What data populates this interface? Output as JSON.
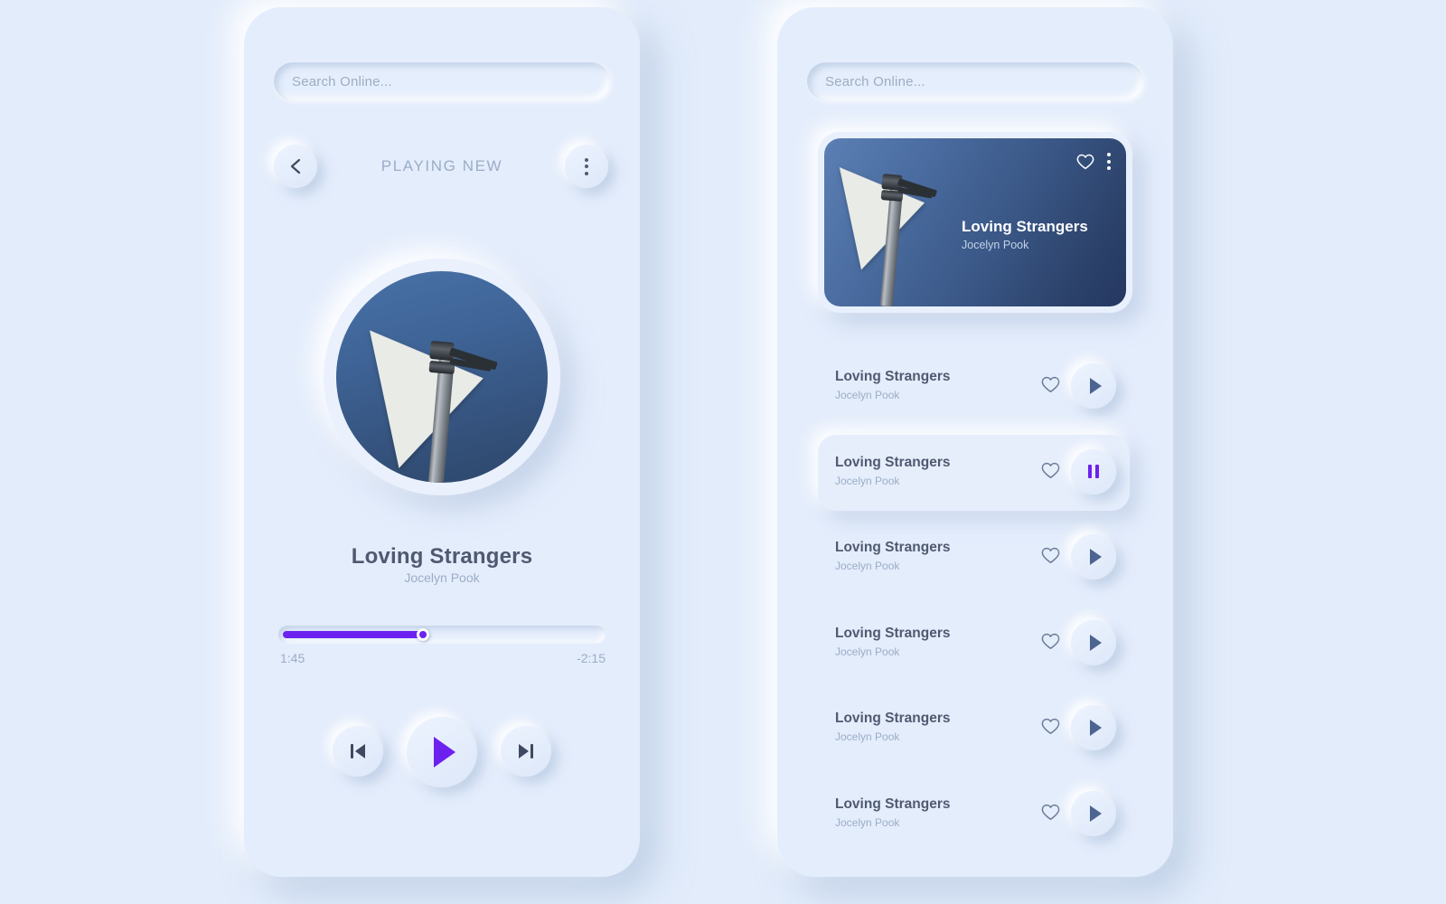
{
  "theme": {
    "background": "#e2ecfb",
    "panel": "#e4edfc",
    "accent_purple": "#6d21ef",
    "text_dark": "#4f5a70",
    "text_muted": "#9badc6",
    "photo_blue": "#3a5786"
  },
  "player": {
    "search": {
      "placeholder": "Search Online...",
      "value": ""
    },
    "header": {
      "title": "PLAYING NEW",
      "back_icon": "chevron-left-icon",
      "menu_icon": "more-vertical-icon"
    },
    "artwork": {
      "alt": "arrow road sign on metal pole against blue sky"
    },
    "now_playing": {
      "title": "Loving Strangers",
      "artist": "Jocelyn Pook"
    },
    "progress": {
      "percent": 44,
      "elapsed": "1:45",
      "remaining": "-2:15"
    },
    "controls": {
      "previous": "skip-previous-icon",
      "play": "play-icon",
      "next": "skip-next-icon",
      "state": "playing"
    }
  },
  "playlist": {
    "search": {
      "placeholder": "Search Online...",
      "value": ""
    },
    "featured": {
      "title": "Loving Strangers",
      "artist": "Jocelyn Pook",
      "favorite_icon": "heart-outline-icon",
      "menu_icon": "more-vertical-icon",
      "favorited": false
    },
    "tracks": [
      {
        "title": "Loving Strangers",
        "artist": "Jocelyn Pook",
        "state": "paused",
        "action_icon": "play-icon",
        "favorited": false,
        "active": false
      },
      {
        "title": "Loving Strangers",
        "artist": "Jocelyn Pook",
        "state": "playing",
        "action_icon": "pause-icon",
        "favorited": false,
        "active": true
      },
      {
        "title": "Loving Strangers",
        "artist": "Jocelyn Pook",
        "state": "paused",
        "action_icon": "play-icon",
        "favorited": false,
        "active": false
      },
      {
        "title": "Loving Strangers",
        "artist": "Jocelyn Pook",
        "state": "paused",
        "action_icon": "play-icon",
        "favorited": false,
        "active": false
      },
      {
        "title": "Loving Strangers",
        "artist": "Jocelyn Pook",
        "state": "paused",
        "action_icon": "play-icon",
        "favorited": false,
        "active": false
      },
      {
        "title": "Loving Strangers",
        "artist": "Jocelyn Pook",
        "state": "paused",
        "action_icon": "play-icon",
        "favorited": false,
        "active": false
      }
    ]
  }
}
